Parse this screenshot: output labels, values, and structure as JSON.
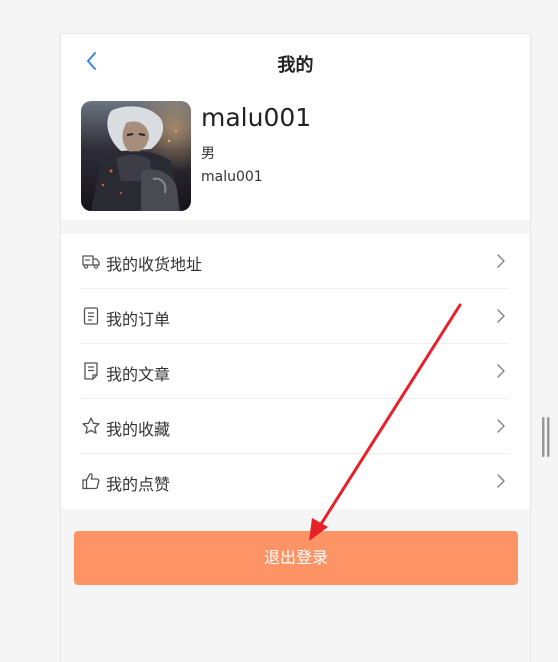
{
  "navbar": {
    "title": "我的",
    "back_icon": "chevron-left-icon"
  },
  "profile": {
    "username": "malu001",
    "gender": "男",
    "account": "malu001",
    "avatar": "avatar-image"
  },
  "menu": {
    "items": [
      {
        "label": "我的收货地址",
        "icon": "truck-icon"
      },
      {
        "label": "我的订单",
        "icon": "order-list-icon"
      },
      {
        "label": "我的文章",
        "icon": "article-icon"
      },
      {
        "label": "我的收藏",
        "icon": "star-icon"
      },
      {
        "label": "我的点赞",
        "icon": "thumbs-up-icon"
      }
    ]
  },
  "logout": {
    "label": "退出登录",
    "color": "#fe9466"
  },
  "colors": {
    "accent_blue": "#3a86e8",
    "annotation_red": "#e8202a",
    "background": "#f5f5f5"
  }
}
